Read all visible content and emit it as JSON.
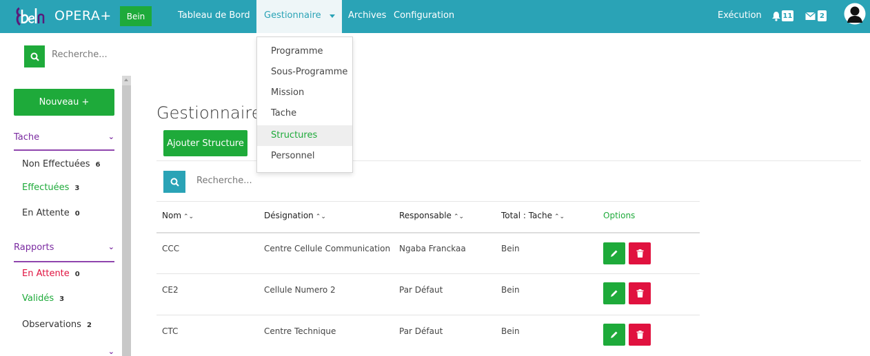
{
  "navbar": {
    "brand_title": "OPERA+",
    "brand_badge": "Bein",
    "items": [
      {
        "label": "Tableau de Bord"
      },
      {
        "label": "Gestionnaire"
      },
      {
        "label": "Archives"
      },
      {
        "label": "Configuration"
      }
    ],
    "execution_label": "Exécution",
    "notifications_count": "11",
    "messages_count": "2"
  },
  "dropdown": {
    "items": [
      {
        "label": "Programme"
      },
      {
        "label": "Sous-Programme"
      },
      {
        "label": "Mission"
      },
      {
        "label": "Tache"
      },
      {
        "label": "Structures"
      },
      {
        "label": "Personnel"
      }
    ]
  },
  "sidebar": {
    "search_placeholder": "Recherche...",
    "new_button": "Nouveau +",
    "sections": [
      {
        "title": "Tache"
      },
      {
        "title": "Rapports"
      }
    ],
    "tache_links": [
      {
        "label": "Non Effectuées",
        "count": "6"
      },
      {
        "label": "Effectuées",
        "count": "3"
      },
      {
        "label": "En Attente",
        "count": "0"
      }
    ],
    "rapport_links": [
      {
        "label": "En Attente",
        "count": "0"
      },
      {
        "label": "Validés",
        "count": "3"
      },
      {
        "label": "Observations",
        "count": "2"
      }
    ]
  },
  "main": {
    "title": "Gestionnaire",
    "add_button": "Ajouter Structure",
    "search_placeholder": "Recherche...",
    "columns": [
      "Nom",
      "Désignation",
      "Responsable",
      "Total : Tache",
      "Options"
    ],
    "rows": [
      {
        "nom": "CCC",
        "designation": "Centre Cellule Communication",
        "responsable": "Ngaba Franckaa",
        "total": "Bein"
      },
      {
        "nom": "CE2",
        "designation": "Cellule Numero 2",
        "responsable": "Par Défaut",
        "total": "Bein"
      },
      {
        "nom": "CTC",
        "designation": "Centre Technique",
        "responsable": "Par Défaut",
        "total": "Bein"
      }
    ]
  },
  "colors": {
    "navbar": "#2aa3b6",
    "green": "#1eaa3a",
    "red": "#e0123f",
    "purple": "#7a2aa0"
  }
}
